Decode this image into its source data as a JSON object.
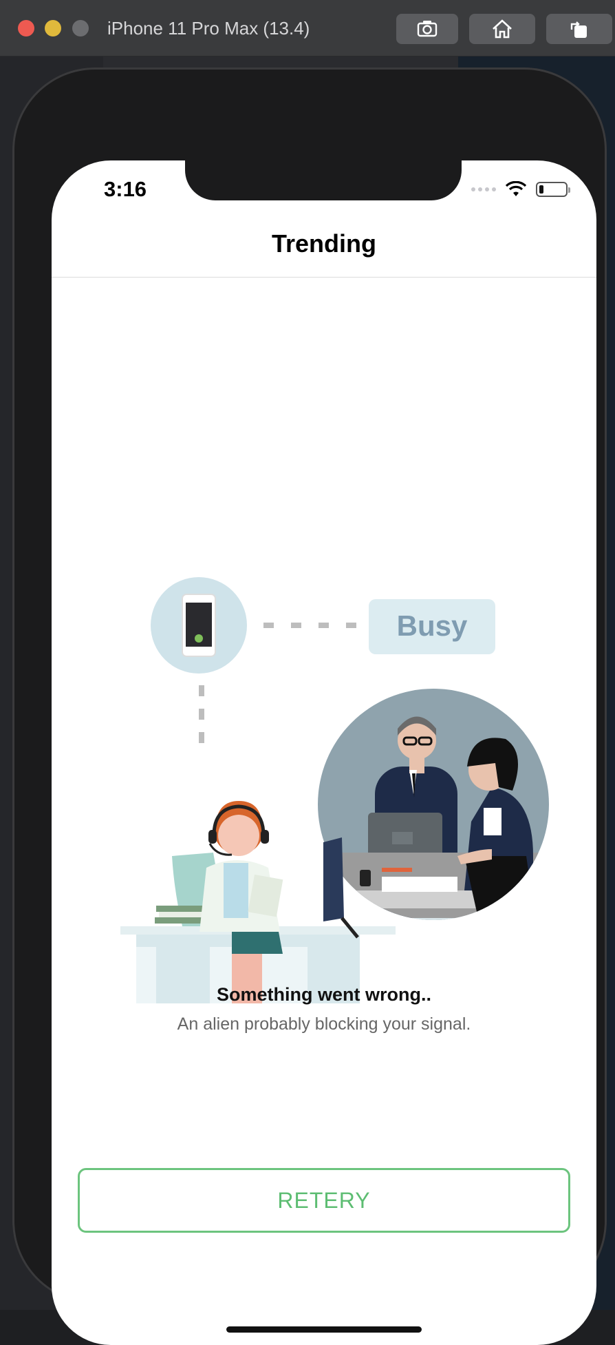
{
  "simulator": {
    "title": "iPhone 11 Pro Max (13.4)",
    "buttons": [
      {
        "name": "screenshot",
        "icon": "camera-icon"
      },
      {
        "name": "home",
        "icon": "home-icon"
      },
      {
        "name": "rotate",
        "icon": "rotate-icon"
      }
    ]
  },
  "status_bar": {
    "time": "3:16"
  },
  "nav": {
    "title": "Trending"
  },
  "illustration": {
    "badge_text": "Busy"
  },
  "error": {
    "title": "Something went wrong..",
    "message": "An alien probably blocking your signal."
  },
  "retry_button": {
    "label": "RETERY"
  },
  "colors": {
    "accent_green": "#5dbd72",
    "badge_bg": "#dcecf1",
    "badge_text": "#7f9cb1"
  }
}
